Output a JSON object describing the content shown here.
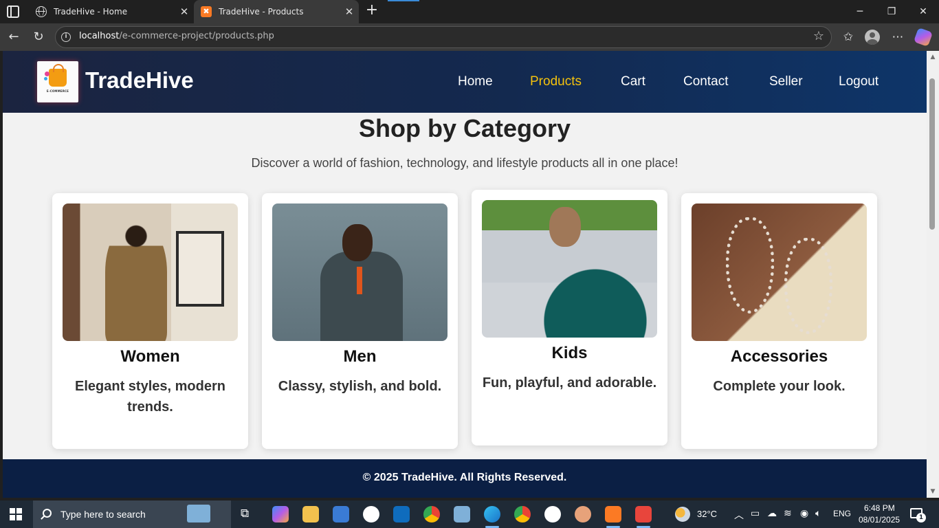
{
  "browser": {
    "tabs": [
      {
        "title": "TradeHive - Home",
        "icon": "globe-icon"
      },
      {
        "title": "TradeHive - Products",
        "icon": "xampp-icon"
      }
    ],
    "url_host": "localhost",
    "url_path": "/e-commerce-project/products.php"
  },
  "site": {
    "brand": "TradeHive",
    "logo_caption": "E-COMMERCE",
    "nav": [
      "Home",
      "Products",
      "Cart",
      "Contact",
      "Seller",
      "Logout"
    ],
    "active_nav": "Products",
    "colors": {
      "header": "#13294f",
      "active_nav": "#f4c20d",
      "footer": "#0b1f44"
    }
  },
  "main": {
    "title": "Shop by Category",
    "subtitle": "Discover a world of fashion, technology, and lifestyle products all in one place!",
    "categories": [
      {
        "name": "Women",
        "description": "Elegant styles, modern trends."
      },
      {
        "name": "Men",
        "description": "Classy, stylish, and bold."
      },
      {
        "name": "Kids",
        "description": "Fun, playful, and adorable."
      },
      {
        "name": "Accessories",
        "description": "Complete your look."
      }
    ]
  },
  "footer": {
    "text": "© 2025 TradeHive. All Rights Reserved."
  },
  "taskbar": {
    "search_placeholder": "Type here to search",
    "temperature": "32°C",
    "language": "ENG",
    "time": "6:48 PM",
    "date": "08/01/2025",
    "notifications": "1"
  }
}
